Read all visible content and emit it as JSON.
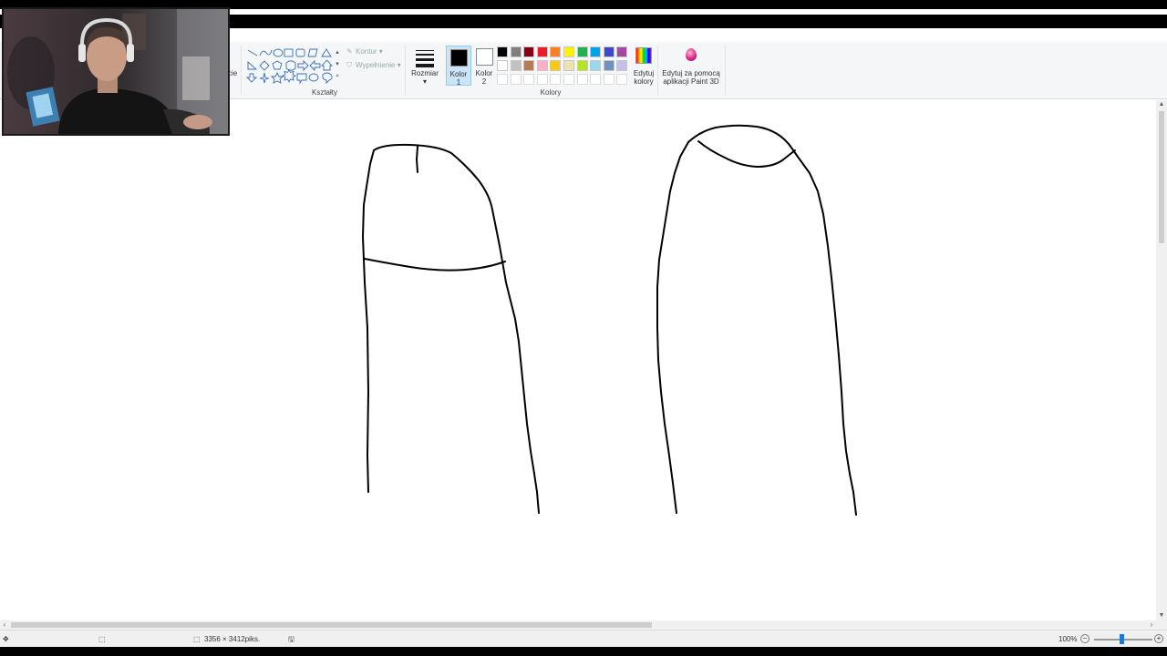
{
  "ribbon": {
    "shapes_group_label": "Kształty",
    "outline_label": "Kontur",
    "fill_label": "Wypełnienie",
    "size_label": "Rozmiar",
    "color1_label_line1": "Kolor",
    "color1_label_line2": "1",
    "color2_label_line1": "Kolor",
    "color2_label_line2": "2",
    "colors_group_label": "Kolory",
    "edit_colors_line1": "Edytuj",
    "edit_colors_line2": "kolory",
    "paint3d_line1": "Edytuj za pomocą",
    "paint3d_line2": "aplikacji Paint 3D",
    "partial_tool_label": "cie"
  },
  "colors": {
    "color1": "#000000",
    "color2": "#ffffff",
    "palette_row1": [
      "#000000",
      "#7f7f7f",
      "#880015",
      "#ed1c24",
      "#ff7f27",
      "#fff200",
      "#22b14c",
      "#00a2e8",
      "#3f48cc",
      "#a349a4"
    ],
    "palette_row2": [
      "#ffffff",
      "#c3c3c3",
      "#b97a57",
      "#ffaec9",
      "#ffc90e",
      "#efe4b0",
      "#b5e61d",
      "#99d9ea",
      "#7092be",
      "#c8bfe7"
    ]
  },
  "status": {
    "image_size": "3356 × 3412piks.",
    "zoom": "100%"
  }
}
